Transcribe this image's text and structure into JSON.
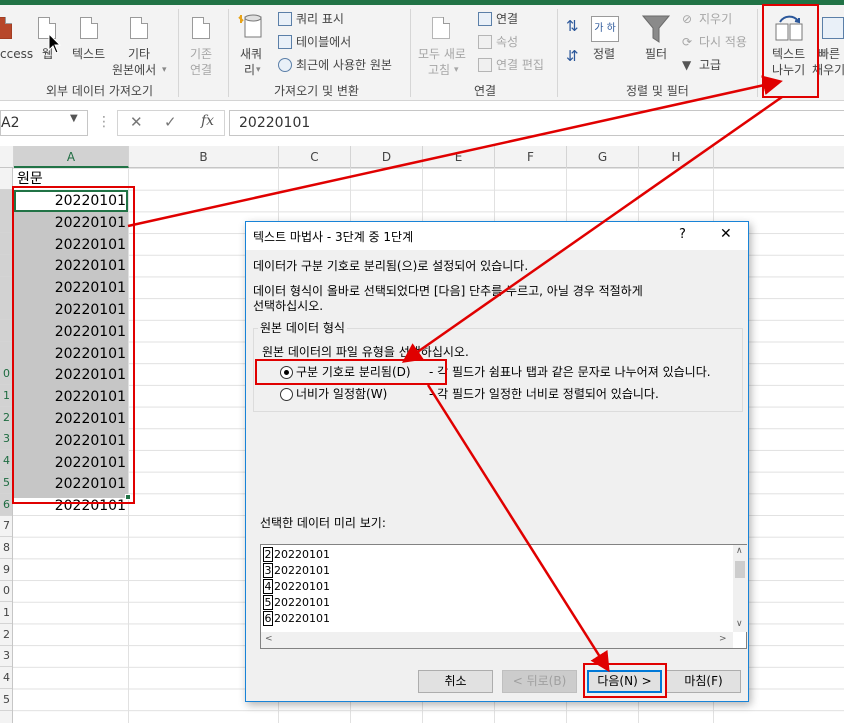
{
  "ribbon": {
    "get_external": {
      "access": "ccess",
      "web": "웹",
      "text": "텍스트",
      "other_line1": "기타",
      "other_line2": "원본에서",
      "label": "외부 데이터 가져오기"
    },
    "existing_line1": "기존",
    "existing_line2": "연결",
    "get_transform": {
      "new_query_line1": "새쿼",
      "new_query_line2": "리",
      "show_queries": "쿼리 표시",
      "from_table": "테이블에서",
      "recent_sources": "최근에 사용한 원본",
      "label": "가져오기 및 변환"
    },
    "connections": {
      "refresh_line1": "모두 새로",
      "refresh_line2": "고침",
      "connections": "연결",
      "properties": "속성",
      "edit_links": "연결 편집",
      "label": "연결"
    },
    "sort_filter": {
      "sort_az": "↓",
      "sort": "정렬",
      "sort_icon": "가 하",
      "filter": "필터",
      "clear": "지우기",
      "reapply": "다시 적용",
      "advanced": "고급",
      "label": "정렬 및 필터"
    },
    "data_tools": {
      "text_to_columns_line1": "텍스트",
      "text_to_columns_line2": "나누기",
      "flash_fill_line1": "빠른",
      "flash_fill_line2": "채우기"
    }
  },
  "formula_bar": {
    "name_box": "A2",
    "cancel": "✕",
    "enter": "✓",
    "fx": "fx",
    "formula": "20220101"
  },
  "sheet": {
    "columns": [
      "A",
      "B",
      "C",
      "D",
      "E",
      "F",
      "G",
      "H"
    ],
    "rows": [
      "",
      "",
      "",
      "",
      "",
      "",
      "",
      "",
      "",
      "0",
      "1",
      "2",
      "3",
      "4",
      "5",
      "6",
      "7",
      "8",
      "9",
      "0",
      "1",
      "2",
      "3",
      "4",
      "5"
    ],
    "a1": "원문",
    "values": [
      "20220101",
      "20220101",
      "20220101",
      "20220101",
      "20220101",
      "20220101",
      "20220101",
      "20220101",
      "20220101",
      "20220101",
      "20220101",
      "20220101",
      "20220101",
      "20220101",
      "20220101"
    ]
  },
  "dialog": {
    "title": "텍스트 마법사 - 3단계 중 1단계",
    "help": "?",
    "close": "✕",
    "line1": "데이터가 구분 기호로 분리됨(으)로 설정되어 있습니다.",
    "line2": "데이터 형식이 올바로 선택되었다면 [다음] 단추를 누르고, 아닐 경우 적절하게",
    "line3": "선택하십시오.",
    "group_title": "원본 데이터 형식",
    "group_prompt": "원본 데이터의 파일 유형을 선택하십시오.",
    "option_delimited": "구분 기호로 분리됨(D)",
    "option_delimited_desc": "- 각 필드가 쉼표나 탭과 같은 문자로 나누어져 있습니다.",
    "option_fixed": "너비가 일정함(W)",
    "option_fixed_desc": "- 각 필드가 일정한 너비로 정렬되어 있습니다.",
    "preview_label": "선택한 데이터 미리 보기:",
    "preview": [
      {
        "num": "2",
        "text": "20220101"
      },
      {
        "num": "3",
        "text": "20220101"
      },
      {
        "num": "4",
        "text": "20220101"
      },
      {
        "num": "5",
        "text": "20220101"
      },
      {
        "num": "6",
        "text": "20220101"
      }
    ],
    "buttons": {
      "cancel": "취소",
      "back": "< 뒤로(B)",
      "next": "다음(N) >",
      "finish": "마침(F)"
    }
  },
  "colors": {
    "excel_green": "#217346",
    "annotation_red": "#e00000",
    "dialog_border": "#1883d7"
  }
}
